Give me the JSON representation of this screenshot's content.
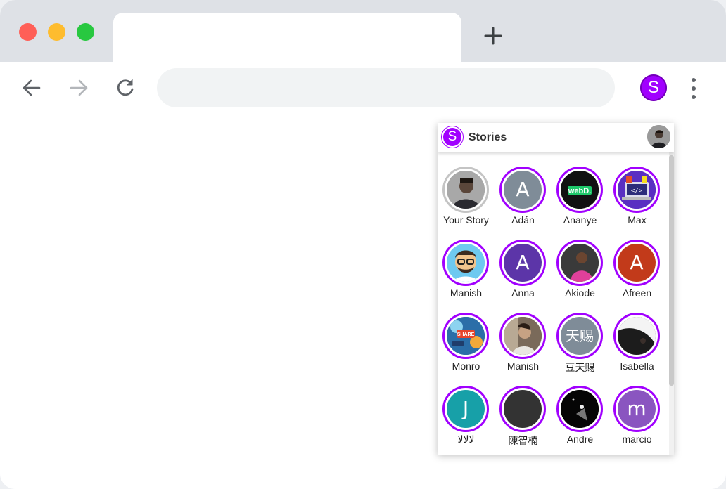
{
  "browser": {
    "tab_title": "",
    "newtab_icon": "plus-icon",
    "address": {
      "value": "",
      "placeholder": ""
    },
    "extension_letter": "S",
    "colors": {
      "extension": "#a100ff",
      "tabstrip": "#dee1e6",
      "omnibox": "#f1f3f4"
    }
  },
  "popup": {
    "logo_letter": "S",
    "title": "Stories",
    "stories": [
      {
        "name": "Your Story",
        "type": "photo",
        "own": true
      },
      {
        "name": "Adán",
        "type": "letter",
        "letter": "A",
        "bg": "#7f8c98"
      },
      {
        "name": "Ananye",
        "type": "logo",
        "logo_text": "webD.",
        "bg": "#111111"
      },
      {
        "name": "Max",
        "type": "code",
        "bg": "#5a2fc2"
      },
      {
        "name": "Manish",
        "type": "emoji",
        "bg": "#6ec9f0"
      },
      {
        "name": "Anna",
        "type": "letter",
        "letter": "A",
        "bg": "#5c35a8"
      },
      {
        "name": "Akiode",
        "type": "photo_pink",
        "bg": "#4a4a4a"
      },
      {
        "name": "Afreen",
        "type": "letter",
        "letter": "A",
        "bg": "#c23a1a"
      },
      {
        "name": "Monro",
        "type": "share",
        "share_text": "SHARE",
        "bg": "#2b6ea8"
      },
      {
        "name": "Manish",
        "type": "photo_gray",
        "bg": "#6b5b4c"
      },
      {
        "name": "豆天赐",
        "type": "letter",
        "letter": "天赐",
        "bg": "#7f8c98"
      },
      {
        "name": "Isabella",
        "type": "photo_dark",
        "bg": "#2a2a2a"
      },
      {
        "name": "ﻻﻻﻻ",
        "type": "letter",
        "letter": "J",
        "bg": "#17a0a8"
      },
      {
        "name": "陳智楠",
        "type": "blank",
        "bg": "#333333"
      },
      {
        "name": "Andre",
        "type": "photo_night",
        "bg": "#111111"
      },
      {
        "name": "marcio",
        "type": "letter",
        "letter": "m",
        "bg": "#8a55c0"
      }
    ]
  }
}
